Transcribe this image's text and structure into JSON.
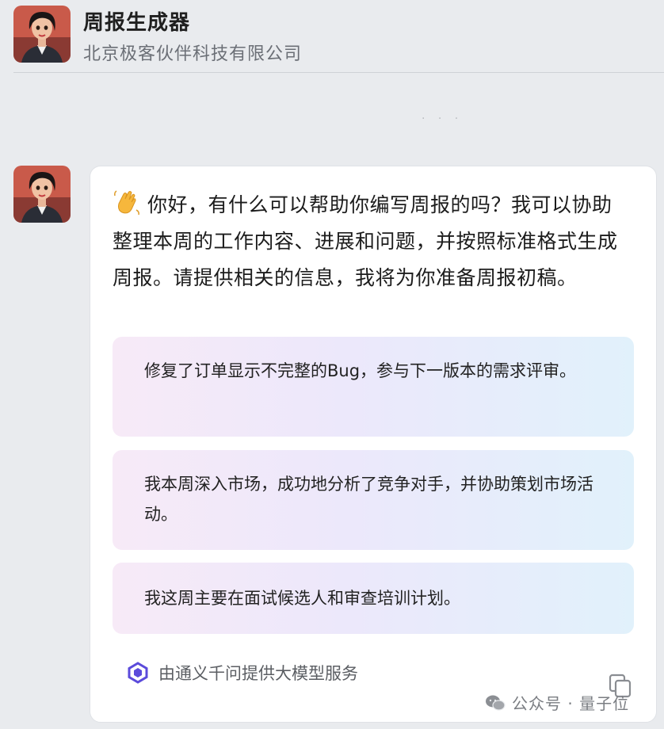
{
  "header": {
    "title": "周报生成器",
    "subtitle": "北京极客伙伴科技有限公司",
    "avatar_icon": "woman-avatar-icon"
  },
  "separator_dots": "· · ·",
  "message": {
    "greeting": "你好，有什么可以帮助你编写周报的吗？我可以协助整理本周的工作内容、进展和问题，并按照标准格式生成周报。请提供相关的信息，我将为你准备周报初稿。",
    "emoji_icon": "waving-hand-icon",
    "suggestions": [
      "修复了订单显示不完整的Bug，参与下一版本的需求评审。",
      "我本周深入市场，成功地分析了竞争对手，并协助策划市场活动。",
      "我这周主要在面试候选人和审查培训计划。"
    ],
    "powered_by": "由通义千问提供大模型服务",
    "copy_icon": "copy-icon"
  },
  "watermark": {
    "text": "公众号 · 量子位",
    "icon": "wechat-icon"
  },
  "colors": {
    "background": "#e9ebee",
    "bubble": "#ffffff",
    "suggestion_gradient_start": "#f7eaf7",
    "suggestion_gradient_end": "#e1f1fb",
    "accent": "#5b4bdb"
  }
}
